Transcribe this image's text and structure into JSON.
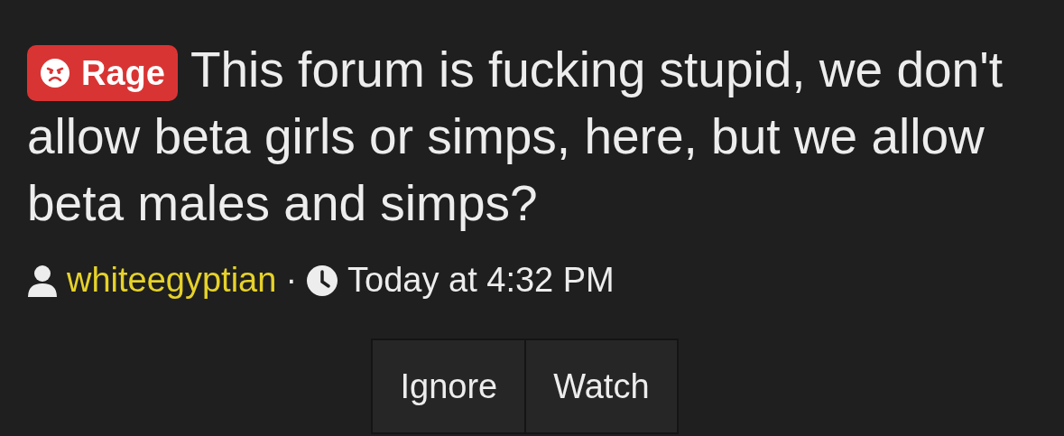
{
  "thread": {
    "prefix": {
      "label": "Rage",
      "color": "#d93434"
    },
    "title": "This forum is fucking stupid, we don't allow beta girls or simps, here, but we allow beta males and simps?",
    "author": "whiteegyptian",
    "separator": "·",
    "date": "Today at 4:32 PM"
  },
  "buttons": [
    {
      "label": "Ignore"
    },
    {
      "label": "Watch"
    }
  ]
}
